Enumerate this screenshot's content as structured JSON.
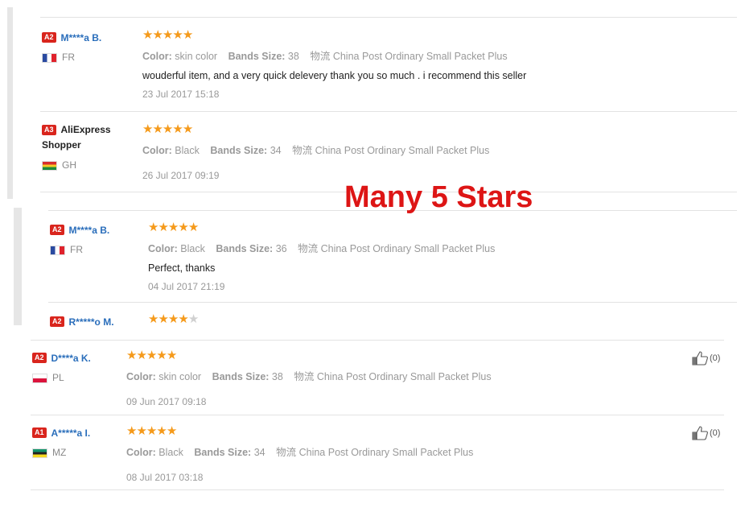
{
  "overlay_text": "Many 5 Stars",
  "labels": {
    "color": "Color:",
    "bands_size": "Bands Size:",
    "shipping": "物流"
  },
  "colors": {
    "star": "#f59a1b",
    "badge": "#d9251d",
    "name": "#2a6ebb",
    "overlay": "#dd1515"
  },
  "reviews": [
    {
      "badge": "A2",
      "name": "M****a B.",
      "flag_icon": "france-flag-icon",
      "country": "FR",
      "rating": 5,
      "color": "skin color",
      "bands_size": "38",
      "shipping": "China Post Ordinary Small Packet Plus",
      "text": "wouderful item, and a very quick delevery thank you so much . i recommend this seller",
      "date": "23 Jul 2017 15:18"
    },
    {
      "badge": "A3",
      "name": "AliExpress Shopper",
      "flag_icon": "ghana-flag-icon",
      "country": "GH",
      "rating": 5,
      "color": "Black",
      "bands_size": "34",
      "shipping": "China Post Ordinary Small Packet Plus",
      "text": "",
      "date": "26 Jul 2017 09:19"
    },
    {
      "badge": "A2",
      "name": "M****a B.",
      "flag_icon": "france-flag-icon",
      "country": "FR",
      "rating": 5,
      "color": "Black",
      "bands_size": "36",
      "shipping": "China Post Ordinary Small Packet Plus",
      "text": "Perfect, thanks",
      "date": "04 Jul 2017 21:19"
    },
    {
      "badge": "A2",
      "name": "R*****o M.",
      "rating": 4
    },
    {
      "badge": "A2",
      "name": "D****a K.",
      "flag_icon": "poland-flag-icon",
      "country": "PL",
      "rating": 5,
      "color": "skin color",
      "bands_size": "38",
      "shipping": "China Post Ordinary Small Packet Plus",
      "text": "",
      "date": "09 Jun 2017 09:18",
      "likes": "(0)"
    },
    {
      "badge": "A1",
      "name": "A*****a I.",
      "flag_icon": "mozambique-flag-icon",
      "country": "MZ",
      "rating": 5,
      "color": "Black",
      "bands_size": "34",
      "shipping": "China Post Ordinary Small Packet Plus",
      "text": "",
      "date": "08 Jul 2017 03:18",
      "likes": "(0)"
    }
  ]
}
